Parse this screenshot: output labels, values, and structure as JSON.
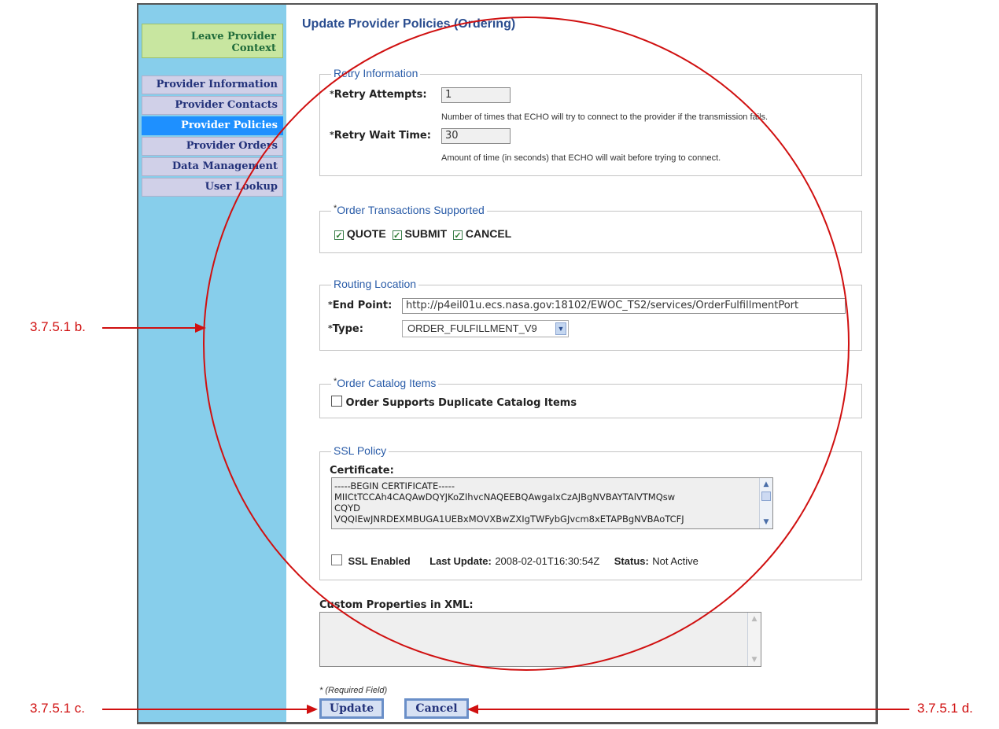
{
  "sidebar": {
    "leave_line1": "Leave Provider",
    "leave_line2": "Context",
    "items": [
      {
        "label": "Provider Information",
        "active": false
      },
      {
        "label": "Provider Contacts",
        "active": false
      },
      {
        "label": "Provider Policies",
        "active": true
      },
      {
        "label": "Provider Orders",
        "active": false
      },
      {
        "label": "Data Management",
        "active": false
      },
      {
        "label": "User Lookup",
        "active": false
      }
    ]
  },
  "page_title": "Update Provider Policies (Ordering)",
  "required_marker": "*",
  "retry": {
    "legend": "Retry Information",
    "attempts_label": "Retry Attempts:",
    "attempts_value": "1",
    "attempts_help": "Number of times that ECHO will try to connect to the provider if the transmission fails.",
    "wait_label": "Retry Wait Time:",
    "wait_value": "30",
    "wait_help": "Amount of time (in seconds) that ECHO will wait before trying to connect."
  },
  "transactions": {
    "legend": "Order Transactions Supported",
    "options": [
      {
        "label": "QUOTE",
        "checked": true
      },
      {
        "label": "SUBMIT",
        "checked": true
      },
      {
        "label": "CANCEL",
        "checked": true
      }
    ]
  },
  "routing": {
    "legend": "Routing Location",
    "endpoint_label": "End Point:",
    "endpoint_value": "http://p4eil01u.ecs.nasa.gov:18102/EWOC_TS2/services/OrderFulfillmentPort",
    "type_label": "Type:",
    "type_value": "ORDER_FULFILLMENT_V9"
  },
  "catalog": {
    "legend": "Order Catalog Items",
    "option_label": "Order Supports Duplicate Catalog Items",
    "checked": false
  },
  "ssl": {
    "legend": "SSL Policy",
    "cert_label": "Certificate:",
    "cert_lines": [
      "-----BEGIN CERTIFICATE-----",
      "MIICtTCCAh4CAQAwDQYJKoZIhvcNAQEEBQAwgaIxCzAJBgNVBAYTAlVTMQsw",
      "CQYD",
      "VQQIEwJNRDEXMBUGA1UEBxMOVXBwZXIgTWFybGJvcm8xETAPBgNVBAoTCFJ"
    ],
    "enabled_label": "SSL Enabled",
    "enabled_checked": false,
    "last_update_label": "Last Update:",
    "last_update_value": "2008-02-01T16:30:54Z",
    "status_label": "Status:",
    "status_value": "Not Active"
  },
  "custom_properties_label": "Custom Properties in XML:",
  "required_note": "* (Required Field)",
  "buttons": {
    "update": "Update",
    "cancel": "Cancel"
  },
  "annotations": {
    "b": "3.7.5.1 b.",
    "c": "3.7.5.1 c.",
    "d": "3.7.5.1 d."
  },
  "annotation_color": "#d01010"
}
